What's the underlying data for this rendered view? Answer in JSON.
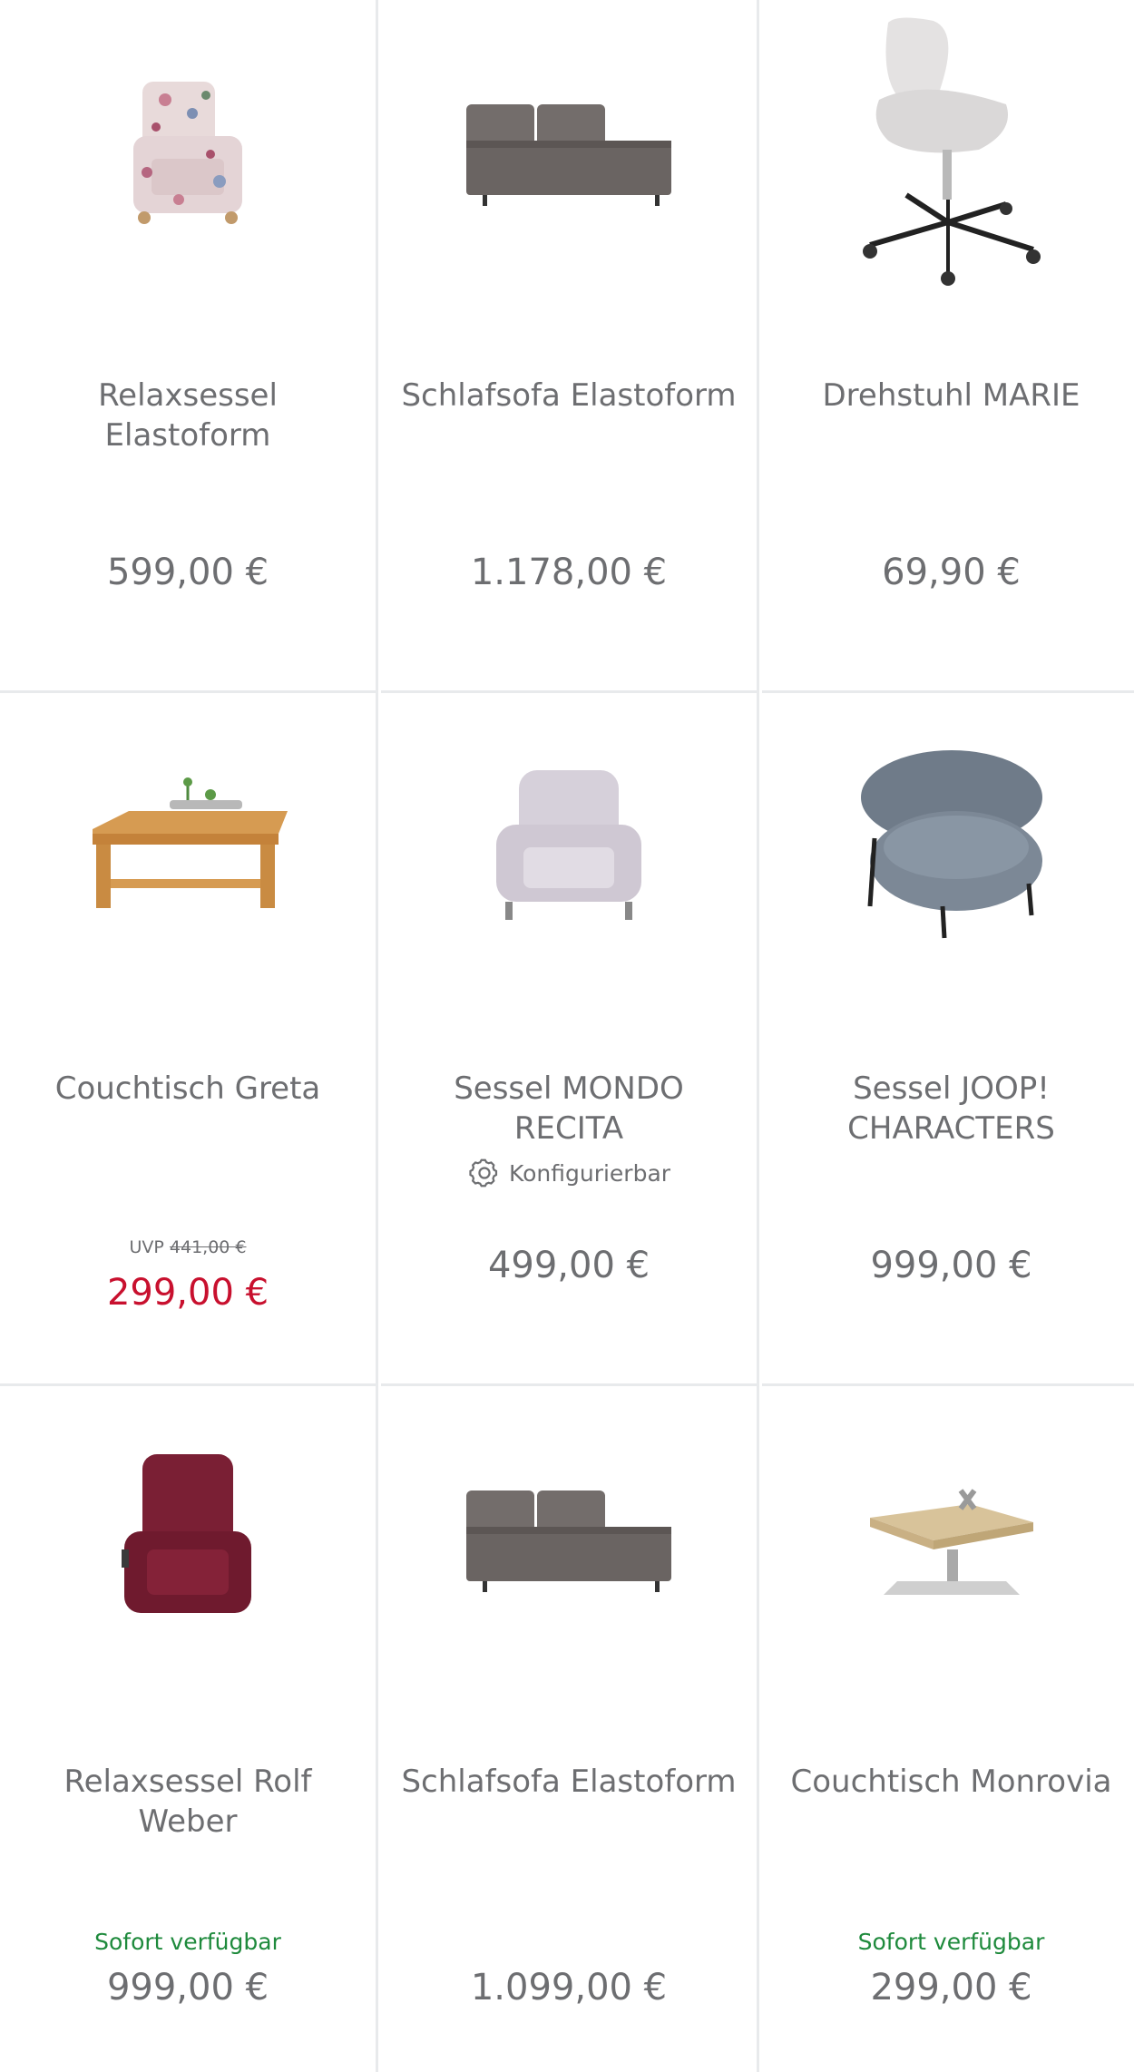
{
  "products": [
    {
      "title": "Relaxsessel Elastoform",
      "price": "599,00 €",
      "image": "floral-armchair"
    },
    {
      "title": "Schlafsofa Elastoform",
      "price": "1.178,00 €",
      "image": "grey-sofa"
    },
    {
      "title": "Drehstuhl MARIE",
      "price": "69,90 €",
      "image": "office-chair"
    },
    {
      "title": "Couchtisch Greta",
      "price": "299,00 €",
      "uvp_label": "UVP",
      "uvp_price": "441,00 €",
      "price_color": "#c8102e",
      "image": "wooden-coffee-table"
    },
    {
      "title": "Sessel MONDO RECITA",
      "config_label": "Konfigurierbar",
      "price": "499,00 €",
      "image": "lilac-recliner"
    },
    {
      "title": "Sessel JOOP! CHARACTERS",
      "price": "999,00 €",
      "image": "round-lounge-chair"
    },
    {
      "title": "Relaxsessel Rolf Weber",
      "availability": "Sofort verfügbar",
      "price": "999,00 €",
      "image": "red-recliner"
    },
    {
      "title": "Schlafsofa Elastoform",
      "price": "1.099,00 €",
      "image": "grey-sofa"
    },
    {
      "title": "Couchtisch Monrovia",
      "availability": "Sofort verfügbar",
      "price": "299,00 €",
      "image": "oak-metal-coffee-table"
    }
  ],
  "colors": {
    "text": "#6d6e71",
    "sale": "#c8102e",
    "available": "#1e8a3c",
    "divider": "#e8eaec"
  }
}
